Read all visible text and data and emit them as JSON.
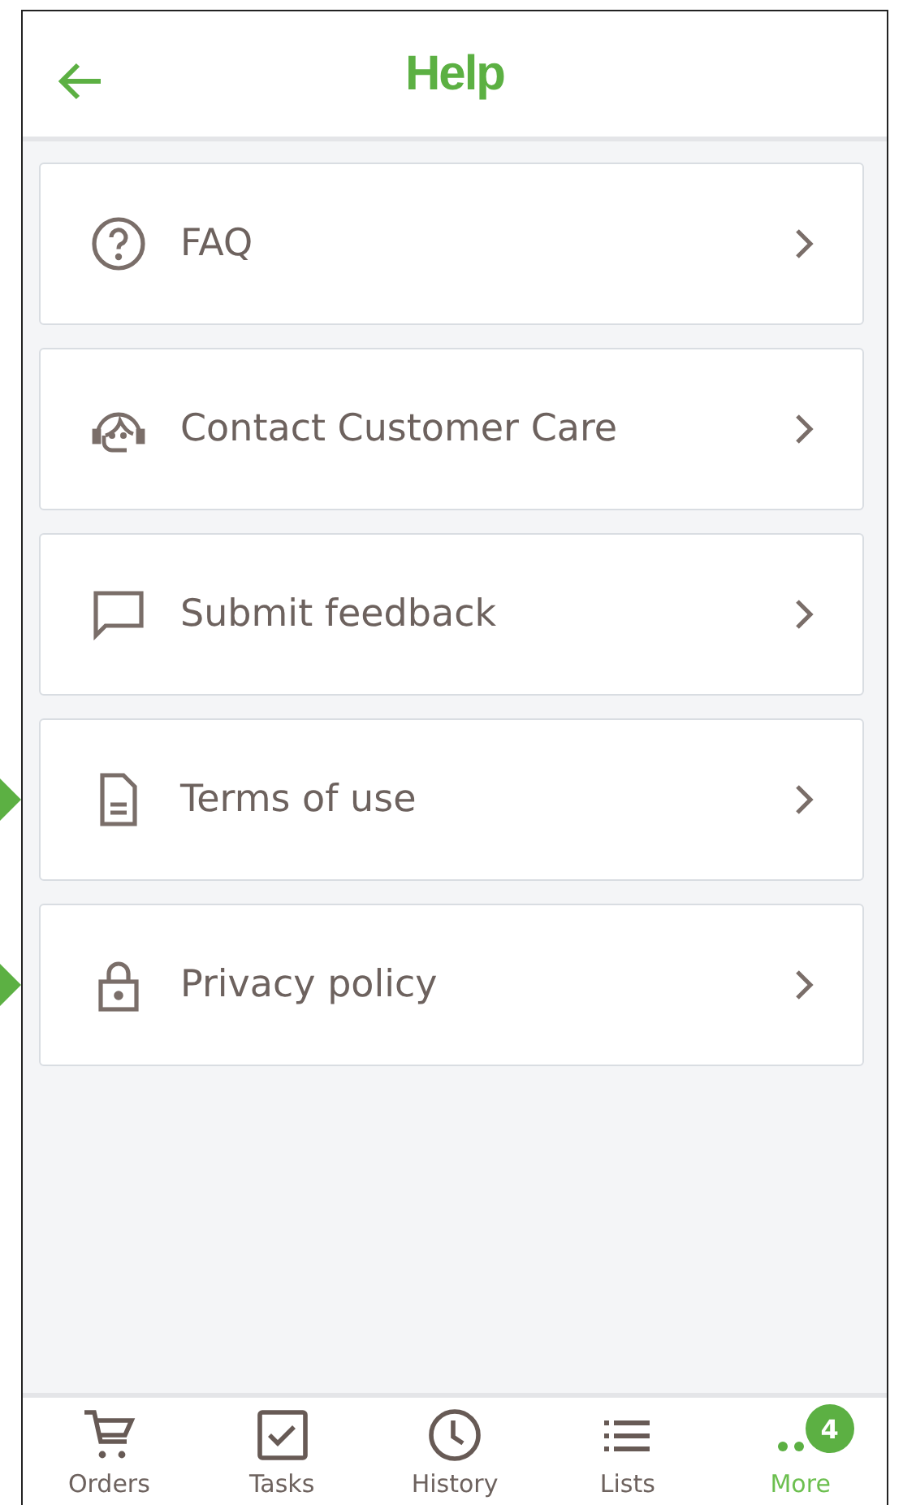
{
  "header": {
    "title": "Help"
  },
  "items": [
    {
      "kind": "question",
      "label": "FAQ",
      "marked": false
    },
    {
      "kind": "headset",
      "label": "Contact Customer Care",
      "marked": false
    },
    {
      "kind": "chat",
      "label": "Submit feedback",
      "marked": false
    },
    {
      "kind": "document",
      "label": "Terms of use",
      "marked": true
    },
    {
      "kind": "lock",
      "label": "Privacy policy",
      "marked": true
    }
  ],
  "nav": [
    {
      "kind": "cart",
      "label": "Orders",
      "selected": false
    },
    {
      "kind": "tasks",
      "label": "Tasks",
      "selected": false
    },
    {
      "kind": "clock",
      "label": "History",
      "selected": false
    },
    {
      "kind": "list",
      "label": "Lists",
      "selected": false
    },
    {
      "kind": "more",
      "label": "More",
      "selected": true,
      "badge": "4"
    }
  ]
}
